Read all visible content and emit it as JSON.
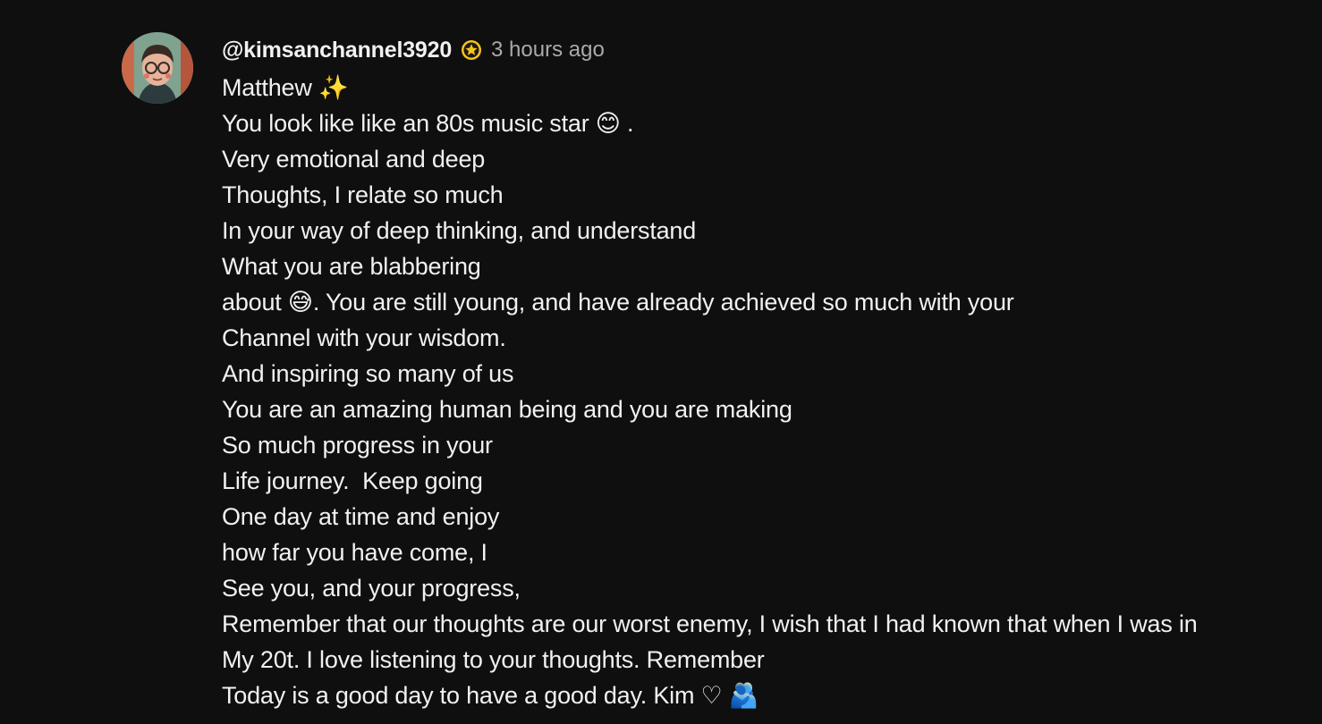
{
  "comment": {
    "author": "@kimsanchannel3920",
    "badge_icon": "star-badge-icon",
    "badge_color": "#f5c518",
    "timestamp": "3 hours ago",
    "lines": [
      "Matthew ✨",
      "You look like like an 80s music star 😊 .",
      "Very emotional and deep",
      "Thoughts, I relate so much",
      "In your way of deep thinking, and understand",
      "What you are blabbering",
      "about 😅. You are still young, and have already achieved so much with your",
      "Channel with your wisdom.",
      "And inspiring so many of us",
      "You are an amazing human being and you are making",
      "So much progress in your",
      "Life journey.  Keep going",
      "One day at time and enjoy",
      "how far you have come, I",
      "See you, and your progress,",
      "Remember that our thoughts are our worst enemy, I wish that I had known that when I was in",
      "My 20t. I love listening to your thoughts. Remember",
      "Today is a good day to have a good day. Kim ♡ 🫂"
    ]
  },
  "colors": {
    "background": "#0f0f0f",
    "text": "#f1f1f1",
    "secondary_text": "#aaaaaa"
  }
}
